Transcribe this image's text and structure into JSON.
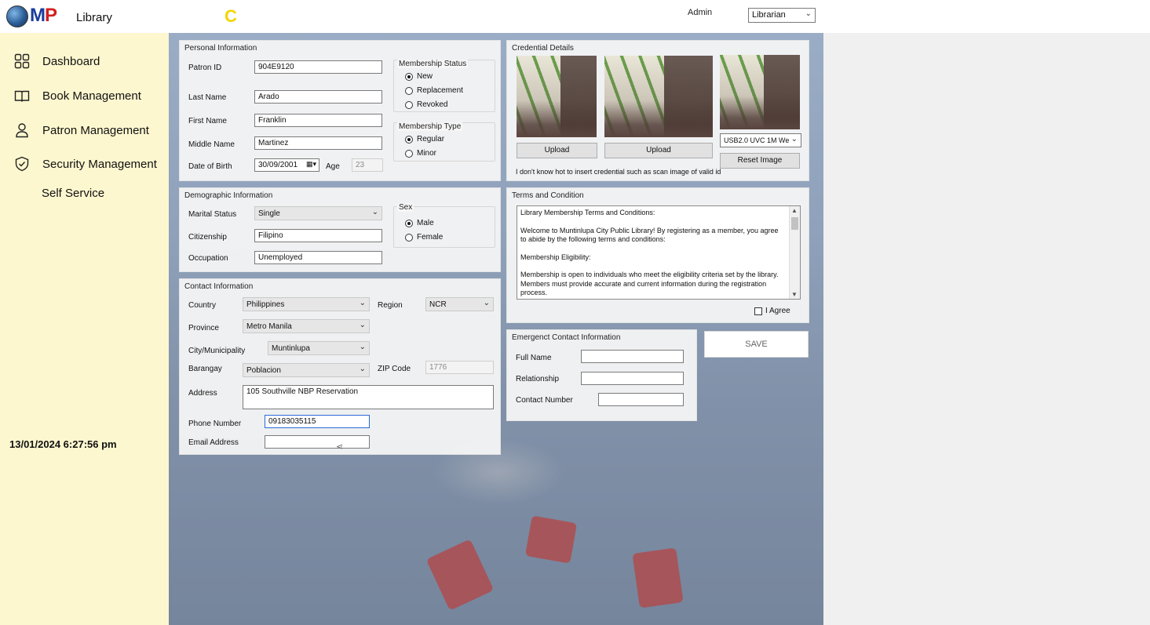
{
  "header": {
    "logo": "MP",
    "logo_m": "M",
    "logo_p": "P",
    "app_title": "Library",
    "loading_glyph": "C",
    "user_label": "Admin",
    "role_select": "Librarian"
  },
  "sidebar": {
    "items": [
      {
        "label": "Dashboard",
        "icon": "dashboard-grid-icon"
      },
      {
        "label": "Book Management",
        "icon": "book-icon"
      },
      {
        "label": "Patron Management",
        "icon": "user-icon"
      },
      {
        "label": "Security Management",
        "icon": "shield-icon"
      }
    ],
    "self_service": "Self Service",
    "clock": "13/01/2024 6:27:56 pm"
  },
  "personal": {
    "title": "Personal Information",
    "patron_id_label": "Patron ID",
    "patron_id": "904E9120",
    "last_name_label": "Last Name",
    "last_name": "Arado",
    "first_name_label": "First Name",
    "first_name": "Franklin",
    "middle_name_label": "Middle Name",
    "middle_name": "Martinez",
    "dob_label": "Date of Birth",
    "dob": "30/09/2001",
    "age_label": "Age",
    "age": "23",
    "membership_status": {
      "title": "Membership Status",
      "options": [
        "New",
        "Replacement",
        "Revoked"
      ],
      "selected": "New"
    },
    "membership_type": {
      "title": "Membership Type",
      "options": [
        "Regular",
        "Minor"
      ],
      "selected": "Regular"
    }
  },
  "credential": {
    "title": "Credential Details",
    "upload_label": "Upload",
    "camera_select": "USB2.0 UVC 1M We",
    "reset_label": "Reset Image",
    "note": "I don't know hot to insert credential such as scan image of valid id"
  },
  "demographic": {
    "title": "Demographic Information",
    "marital_label": "Marital Status",
    "marital": "Single",
    "citizenship_label": "Citizenship",
    "citizenship": "Filipino",
    "occupation_label": "Occupation",
    "occupation": "Unemployed",
    "sex": {
      "title": "Sex",
      "options": [
        "Male",
        "Female"
      ],
      "selected": "Male"
    }
  },
  "terms": {
    "title": "Terms and Condition",
    "paragraphs": [
      "Library Membership Terms and Conditions:",
      "Welcome to Muntinlupa City Public Library! By registering as a member, you agree to abide by the following terms and conditions:",
      "Membership Eligibility:",
      "Membership is open to individuals who meet the eligibility criteria set by the library. Members must provide accurate and current information during the registration process."
    ],
    "agree_label": "I Agree"
  },
  "contact": {
    "title": "Contact Information",
    "country_label": "Country",
    "country": "Philippines",
    "region_label": "Region",
    "region": "NCR",
    "province_label": "Province",
    "province": "Metro Manila",
    "city_label": "City/Municipality",
    "city": "Muntinlupa",
    "barangay_label": "Barangay",
    "barangay": "Poblacion",
    "zip_label": "ZIP Code",
    "zip": "1776",
    "address_label": "Address",
    "address": "105 Southville NBP Reservation",
    "phone_label": "Phone Number",
    "phone": "09183035115",
    "email_label": "Email Address",
    "email": ""
  },
  "emergency": {
    "title": "Emergenct Contact Information",
    "full_name_label": "Full Name",
    "relationship_label": "Relationship",
    "contact_number_label": "Contact  Number"
  },
  "save_label": "SAVE"
}
